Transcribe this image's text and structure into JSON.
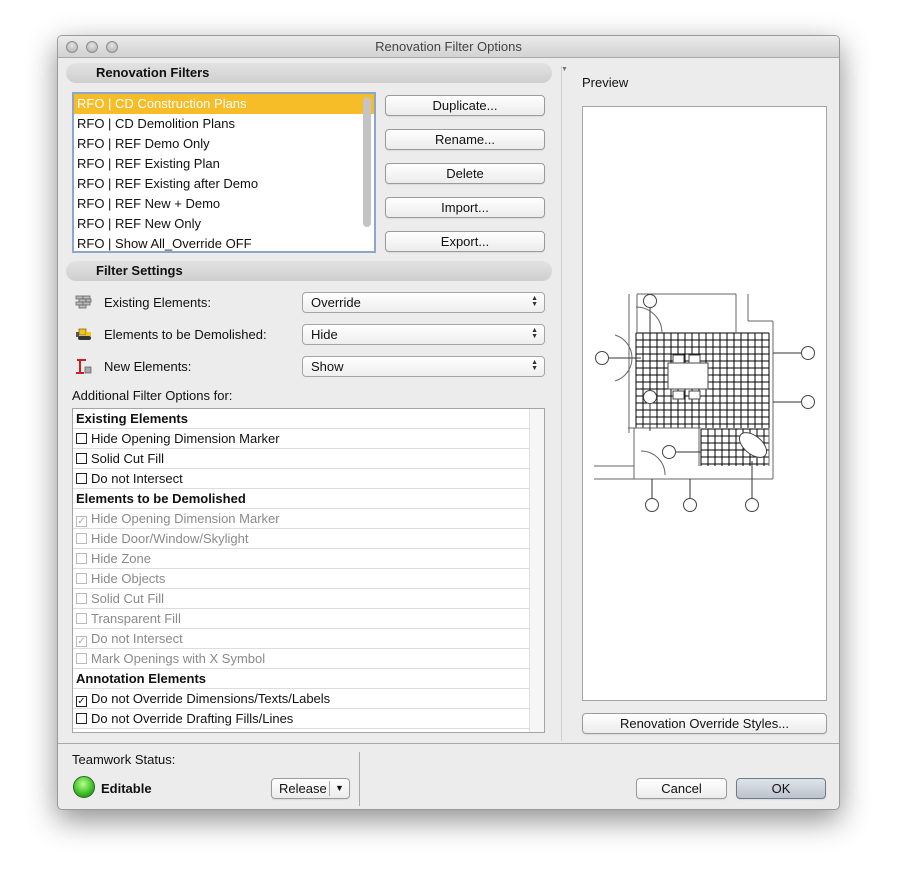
{
  "window": {
    "title": "Renovation Filter Options"
  },
  "renovation_filters": {
    "header": "Renovation Filters",
    "items": [
      {
        "label": "RFO | CD Construction Plans",
        "selected": true
      },
      {
        "label": "RFO | CD Demolition Plans"
      },
      {
        "label": "RFO | REF Demo Only"
      },
      {
        "label": "RFO | REF Existing Plan"
      },
      {
        "label": "RFO | REF Existing after Demo"
      },
      {
        "label": "RFO | REF New + Demo"
      },
      {
        "label": "RFO | REF New Only"
      },
      {
        "label": "RFO | Show All_Override OFF"
      }
    ],
    "buttons": [
      "Duplicate...",
      "Rename...",
      "Delete",
      "Import...",
      "Export..."
    ]
  },
  "filter_settings": {
    "header": "Filter Settings",
    "rows": [
      {
        "icon": "brick-wall-icon",
        "label": "Existing Elements:",
        "value": "Override"
      },
      {
        "icon": "bulldozer-icon",
        "label": "Elements to be Demolished:",
        "value": "Hide"
      },
      {
        "icon": "crane-icon",
        "label": "New Elements:",
        "value": "Show"
      }
    ],
    "additional_label": "Additional Filter Options for:",
    "options": [
      {
        "type": "header",
        "label": "Existing Elements"
      },
      {
        "label": "Hide Opening Dimension Marker",
        "checked": false
      },
      {
        "label": "Solid Cut Fill",
        "checked": false
      },
      {
        "label": "Do not Intersect",
        "checked": false
      },
      {
        "type": "header",
        "label": "Elements to be Demolished"
      },
      {
        "label": "Hide Opening Dimension Marker",
        "checked": true,
        "disabled": true
      },
      {
        "label": "Hide Door/Window/Skylight",
        "checked": false,
        "disabled": true
      },
      {
        "label": "Hide Zone",
        "checked": false,
        "disabled": true
      },
      {
        "label": "Hide Objects",
        "checked": false,
        "disabled": true
      },
      {
        "label": "Solid Cut Fill",
        "checked": false,
        "disabled": true
      },
      {
        "label": "Transparent Fill",
        "checked": false,
        "disabled": true
      },
      {
        "label": "Do not Intersect",
        "checked": true,
        "disabled": true
      },
      {
        "label": "Mark Openings with X Symbol",
        "checked": false,
        "disabled": true
      },
      {
        "type": "header",
        "label": "Annotation Elements"
      },
      {
        "label": "Do not Override Dimensions/Texts/Labels",
        "checked": true
      },
      {
        "label": "Do not Override Drafting Fills/Lines",
        "checked": false
      }
    ]
  },
  "preview": {
    "label": "Preview",
    "styles_button": "Renovation Override Styles..."
  },
  "teamwork": {
    "label": "Teamwork Status:",
    "status": "Editable",
    "status_color": "#3fc22a",
    "release_button": "Release"
  },
  "footer": {
    "cancel": "Cancel",
    "ok": "OK"
  }
}
